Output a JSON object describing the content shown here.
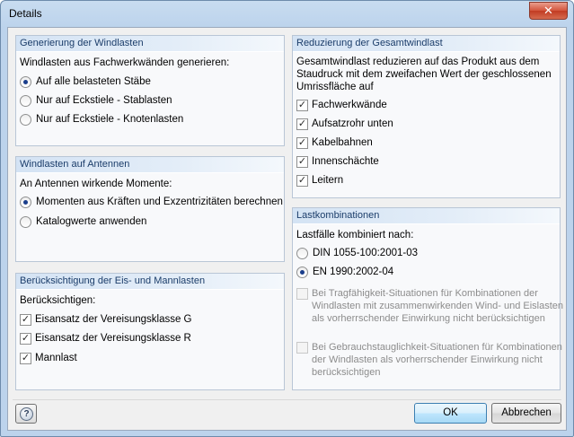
{
  "window": {
    "title": "Details",
    "close_label": "✕"
  },
  "windlasten": {
    "header": "Generierung der Windlasten",
    "prompt": "Windlasten aus Fachwerkwänden generieren:",
    "options": [
      {
        "label": "Auf alle belasteten Stäbe",
        "checked": true
      },
      {
        "label": "Nur auf Eckstiele - Stablasten",
        "checked": false
      },
      {
        "label": "Nur auf Eckstiele - Knotenlasten",
        "checked": false
      }
    ]
  },
  "antennen": {
    "header": "Windlasten auf Antennen",
    "prompt": "An Antennen wirkende Momente:",
    "options": [
      {
        "label": "Momenten aus Kräften und Exzentrizitäten berechnen",
        "checked": true
      },
      {
        "label": "Katalogwerte anwenden",
        "checked": false
      }
    ]
  },
  "eislasten": {
    "header": "Berücksichtigung der Eis- und Mannlasten",
    "prompt": "Berücksichtigen:",
    "options": [
      {
        "label": "Eisansatz der Vereisungsklasse G",
        "checked": true
      },
      {
        "label": "Eisansatz der Vereisungsklasse R",
        "checked": true
      },
      {
        "label": "Mannlast",
        "checked": true
      }
    ]
  },
  "reduzierung": {
    "header": "Reduzierung der Gesamtwindlast",
    "description_lines": [
      "Gesamtwindlast reduzieren auf das Produkt aus dem",
      "Staudruck mit dem zweifachen Wert der geschlossenen",
      "Umrissfläche auf"
    ],
    "options": [
      {
        "label": "Fachwerkwände",
        "checked": true
      },
      {
        "label": "Aufsatzrohr unten",
        "checked": true
      },
      {
        "label": "Kabelbahnen",
        "checked": true
      },
      {
        "label": "Innenschächte",
        "checked": true
      },
      {
        "label": "Leitern",
        "checked": true
      }
    ]
  },
  "lastkombinationen": {
    "header": "Lastkombinationen",
    "prompt": "Lastfälle kombiniert nach:",
    "options": [
      {
        "label": "DIN 1055-100:2001-03",
        "checked": false
      },
      {
        "label": "EN 1990:2002-04",
        "checked": true
      }
    ],
    "trag_lines": [
      "Bei Tragfähigkeit-Situationen für Kombinationen der",
      "Windlasten mit zusammenwirkenden Wind- und Eislasten",
      "als vorherrschender Einwirkung nicht berücksichtigen"
    ],
    "gebrauch_lines": [
      "Bei Gebrauchstauglichkeit-Situationen für Kombinationen",
      "der Windlasten als vorherrschender Einwirkung nicht",
      "berücksichtigen"
    ]
  },
  "footer": {
    "ok_label": "OK",
    "cancel_label": "Abbrechen",
    "help_glyph": "?"
  },
  "colors": {
    "header_text": "#1b3d6a",
    "radio_dot": "#1a3e8c"
  }
}
